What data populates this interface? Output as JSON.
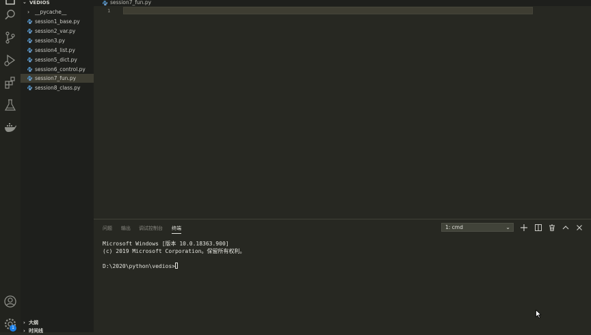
{
  "sidebar": {
    "header": "VEDIOS",
    "items": [
      {
        "label": "__pycache__"
      },
      {
        "label": "session1_base.py"
      },
      {
        "label": "session2_var.py"
      },
      {
        "label": "session3.py"
      },
      {
        "label": "session4_list.py"
      },
      {
        "label": "session5_dict.py"
      },
      {
        "label": "session6_control.py"
      },
      {
        "label": "session7_fun.py"
      },
      {
        "label": "session8_class.py"
      }
    ],
    "outline": "大纲",
    "timeline": "时间线"
  },
  "editor": {
    "tab": "session7_fun.py",
    "line_number": "1"
  },
  "panel": {
    "tabs": [
      "问题",
      "输出",
      "调试控制台",
      "终端"
    ],
    "terminal_select": "1: cmd",
    "terminal_lines": [
      "Microsoft Windows [版本 10.0.18363.900]",
      "(c) 2019 Microsoft Corporation。保留所有权利。",
      "",
      "D:\\2020\\python\\vedios>"
    ]
  },
  "activity": {
    "badge": "1",
    "icons": [
      "explorer-icon",
      "search-icon",
      "source-control-icon",
      "run-debug-icon",
      "extensions-icon",
      "testing-flask-icon",
      "docker-icon",
      "account-icon",
      "settings-gear-icon"
    ]
  },
  "colors": {
    "background": "#272822",
    "sidebar": "#1e1f1c",
    "selection": "#3e3d32",
    "python_icon": "#4b8bbe"
  }
}
